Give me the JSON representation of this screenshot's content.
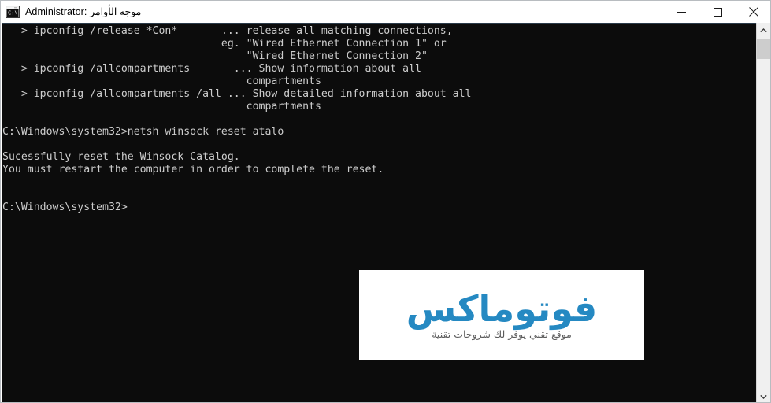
{
  "window": {
    "title": "Administrator: موجه الأوامر",
    "icon": "command-prompt-icon",
    "controls": {
      "minimize_label": "Minimize",
      "maximize_label": "Maximize",
      "close_label": "Close"
    }
  },
  "console": {
    "background_color": "#0c0c0c",
    "text_color": "#cccccc",
    "content": "   > ipconfig /release *Con*       ... release all matching connections,\n                                   eg. \"Wired Ethernet Connection 1\" or\n                                       \"Wired Ethernet Connection 2\"\n   > ipconfig /allcompartments       ... Show information about all\n                                       compartments\n   > ipconfig /allcompartments /all ... Show detailed information about all\n                                       compartments\n\nC:\\Windows\\system32>netsh winsock reset atalo\n\nSucessfully reset the Winsock Catalog.\nYou must restart the computer in order to complete the reset.\n\n\nC:\\Windows\\system32>"
  },
  "watermark": {
    "logo_text": "فوتوماكس",
    "subtitle": "موقع تقني يوفر لك شروحات تقنية",
    "logo_color": "#2589c2",
    "subtitle_color": "#5c5c5c",
    "background_color": "#ffffff"
  },
  "scrollbar": {
    "up_arrow": "chevron-up-icon",
    "down_arrow": "chevron-down-icon",
    "thumb_position_percent": 4
  }
}
